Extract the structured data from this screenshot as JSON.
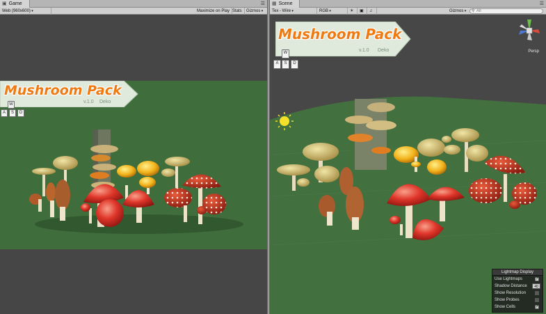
{
  "game": {
    "tab_label": "Game",
    "tab_icon": "game-controller-icon",
    "resolution": "Web (960x600)",
    "maximize_on_play": "Maximize on Play",
    "stats": "Stats",
    "gizmos": "Gizmos",
    "banner": {
      "title": "Mushroom Pack",
      "version": "v.1.0",
      "author": "Deko"
    },
    "keys": [
      "W",
      "A",
      "S",
      "D"
    ]
  },
  "scene": {
    "tab_label": "Scene",
    "tab_icon": "scene-grid-icon",
    "shading_mode": "Tex - Wire",
    "render_mode": "RGB",
    "gizmos": "Gizmos",
    "search_placeholder": "All",
    "banner": {
      "title": "Mushroom Pack",
      "version": "v.1.0",
      "author": "Deko"
    },
    "keys": [
      "W",
      "A",
      "S",
      "D"
    ],
    "projection": "Persp",
    "lightmap": {
      "title": "Lightmap Display",
      "use_lightmaps": "Use Lightmaps",
      "use_lightmaps_checked": true,
      "shadow_distance": "Shadow Distance",
      "shadow_distance_value": "40",
      "show_resolution": "Show Resolution",
      "show_resolution_checked": false,
      "show_probes": "Show Probes",
      "show_probes_checked": false,
      "show_cells": "Show Cells",
      "show_cells_checked": true
    }
  },
  "colors": {
    "ground_game": "#3f6e3c",
    "ground_scene": "#43703f",
    "banner_orange": "#f07a12",
    "banner_bg": "#dfe9dc"
  }
}
